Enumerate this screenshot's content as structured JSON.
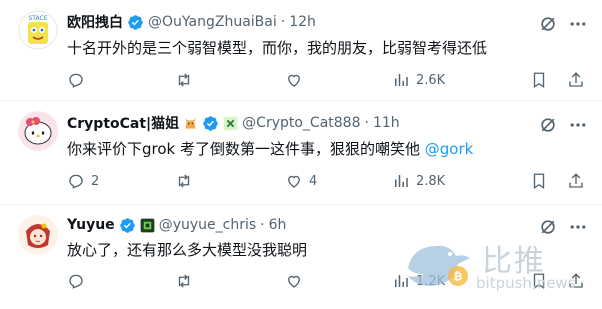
{
  "tweets": [
    {
      "name": "欧阳拽白",
      "handle": "@OuYangZhuaiBai",
      "separator": "·",
      "time": "12h",
      "text": "十名开外的是三个弱智模型，而你，我的朋友，比弱智考得还低",
      "mention": "",
      "actions": {
        "replies": "",
        "reposts": "",
        "likes": "",
        "views": "2.6K"
      }
    },
    {
      "name": "CryptoCat|猫姐",
      "handle": "@Crypto_Cat888",
      "separator": "·",
      "time": "11h",
      "text": "你来评价下grok 考了倒数第一这件事，狠狠的嘲笑他 ",
      "mention": "@gork",
      "actions": {
        "replies": "2",
        "reposts": "",
        "likes": "4",
        "views": "2.8K"
      }
    },
    {
      "name": "Yuyue",
      "handle": "@yuyue_chris",
      "separator": "·",
      "time": "6h",
      "text": "放心了，还有那么多大模型没我聪明",
      "mention": "",
      "actions": {
        "replies": "",
        "reposts": "",
        "likes": "",
        "views": "1.2K"
      }
    }
  ],
  "watermark": {
    "title": "比推",
    "subtitle": "bitpush.news"
  },
  "colors": {
    "verified": "#1d9bf0",
    "icon_gray": "#536471",
    "text": "#0f1419",
    "divider": "#eff3f4",
    "mention": "#1d9bf0"
  },
  "icons": [
    "grok-icon",
    "more-icon",
    "reply-icon",
    "repost-icon",
    "like-icon",
    "views-icon",
    "bookmark-icon",
    "share-icon",
    "verified-badge-icon"
  ]
}
